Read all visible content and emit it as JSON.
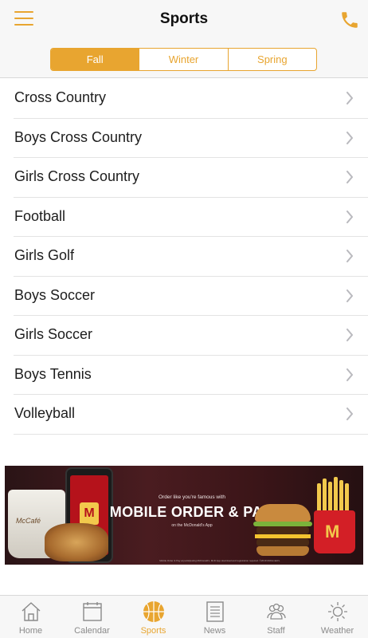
{
  "header": {
    "title": "Sports",
    "menu_icon": "hamburger-menu-icon",
    "phone_icon": "phone-icon",
    "accent_color": "#e8a530"
  },
  "seasons": {
    "selected": "Fall",
    "tabs": [
      {
        "label": "Fall"
      },
      {
        "label": "Winter"
      },
      {
        "label": "Spring"
      }
    ]
  },
  "sports": {
    "items": [
      {
        "label": "Cross Country"
      },
      {
        "label": "Boys Cross Country"
      },
      {
        "label": "Girls Cross Country"
      },
      {
        "label": "Football"
      },
      {
        "label": "Girls Golf"
      },
      {
        "label": "Boys Soccer"
      },
      {
        "label": "Girls Soccer"
      },
      {
        "label": "Boys Tennis"
      },
      {
        "label": "Volleyball"
      }
    ]
  },
  "ad": {
    "tagline": "Order like you're famous with",
    "headline": "MOBILE ORDER & PAY",
    "subline": "on the McDonald's App",
    "cup_label": "McCafé",
    "logo_letter": "M",
    "legal": "Mobile Order & Pay at participating McDonald's. McD App download and registration required. ©2019 McDonald's."
  },
  "tabbar": {
    "active": "Sports",
    "tabs": [
      {
        "label": "Home",
        "icon": "home-icon"
      },
      {
        "label": "Calendar",
        "icon": "calendar-icon"
      },
      {
        "label": "Sports",
        "icon": "basketball-icon"
      },
      {
        "label": "News",
        "icon": "newspaper-icon"
      },
      {
        "label": "Staff",
        "icon": "people-icon"
      },
      {
        "label": "Weather",
        "icon": "sun-icon"
      }
    ]
  }
}
